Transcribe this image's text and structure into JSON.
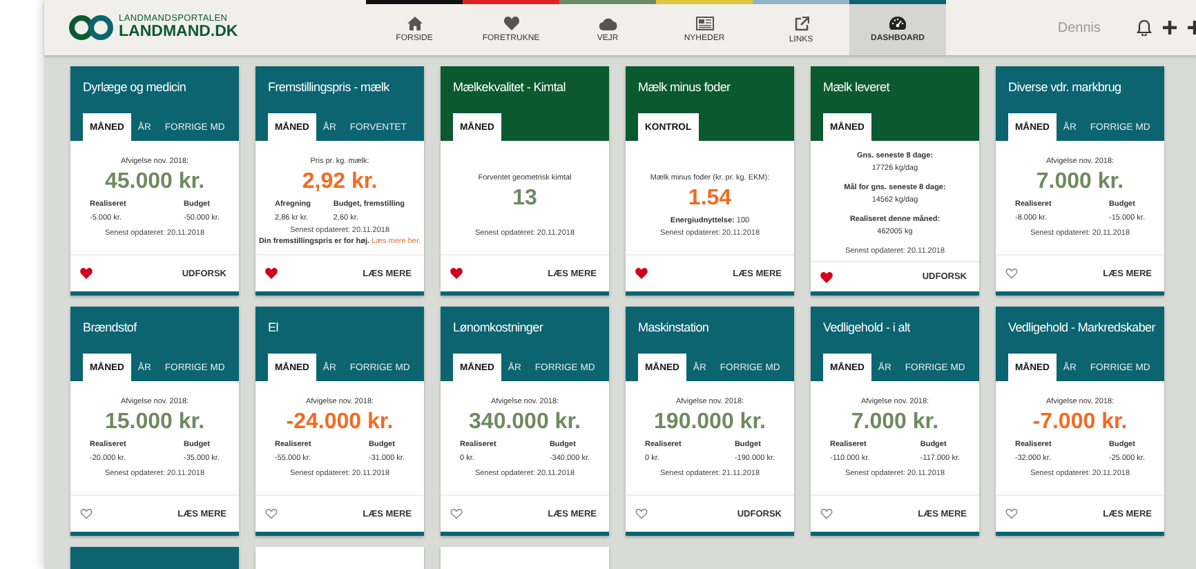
{
  "header": {
    "logo_top": "LANDMANDSPORTALEN",
    "logo_main": "LANDMAND.DK",
    "user": "Dennis"
  },
  "nav": [
    {
      "label": "FORSIDE",
      "color": "#111111",
      "selected": false
    },
    {
      "label": "FORETRUKNE",
      "color": "#e02020",
      "selected": false
    },
    {
      "label": "VEJR",
      "color": "#6f8a6a",
      "selected": false
    },
    {
      "label": "NYHEDER",
      "color": "#e3c53a",
      "selected": false
    },
    {
      "label": "LINKS",
      "color": "#8fb3c6",
      "selected": false
    },
    {
      "label": "DASHBOARD",
      "color": "#0b6470",
      "selected": true
    }
  ],
  "cards": [
    {
      "title": "Dyrlæge og medicin",
      "color": "#0b6470",
      "tabs": [
        {
          "label": "MÅNED",
          "selected": true
        },
        {
          "label": "ÅR",
          "selected": false
        },
        {
          "label": "FORRIGE MD",
          "selected": false
        }
      ],
      "kind": "budget",
      "caption": "Afvigelse nov. 2018:",
      "value": "45.000 kr.",
      "alert": false,
      "cols": [
        {
          "label": "Realiseret",
          "value": "-5.000 kr."
        },
        {
          "label": "Budget",
          "value": "-50.000 kr."
        }
      ],
      "updated": "Senest opdateret: 20.11.2018",
      "favorite": true,
      "action": "UDFORSK"
    },
    {
      "title": "Fremstillingspris - mælk",
      "color": "#0b6470",
      "tabs": [
        {
          "label": "MÅNED",
          "selected": true
        },
        {
          "label": "ÅR",
          "selected": false
        },
        {
          "label": "FORVENTET",
          "selected": false
        }
      ],
      "kind": "budget",
      "caption": "Pris pr. kg. mælk:",
      "value": "2,92 kr.",
      "alert": true,
      "cols": [
        {
          "label": "Afregning",
          "value": "2,86 kr kr."
        },
        {
          "label": "Budget, fremstilling",
          "value": "2,60 kr."
        }
      ],
      "updated": "Senest opdateret: 20.11.2018",
      "note": {
        "text": "Din fremstillingspris er for høj.",
        "link": "Læs mere her."
      },
      "favorite": true,
      "action": "LÆS MERE"
    },
    {
      "title": "Mælkekvalitet - Kimtal",
      "color": "#0b5a2f",
      "tabs": [
        {
          "label": "MÅNED",
          "selected": true
        }
      ],
      "kind": "single",
      "caption": "Forventet geometrisk kimtal",
      "value": "13",
      "alert": false,
      "updated": "Senest opdateret: 20.11.2018",
      "favorite": true,
      "action": "LÆS MERE"
    },
    {
      "title": "Mælk minus foder",
      "color": "#0b5a2f",
      "tabs": [
        {
          "label": "KONTROL",
          "selected": true
        }
      ],
      "kind": "single",
      "caption": "Mælk minus foder (kr. pr. kg. EKM):",
      "value": "1.54",
      "alert": true,
      "extra": "**Energiudnyttelse:** 100",
      "updated": "Senest opdateret: 20.11.2018",
      "favorite": true,
      "action": "LÆS MERE"
    },
    {
      "title": "Mælk leveret",
      "color": "#0b5a2f",
      "tabs": [
        {
          "label": "MÅNED",
          "selected": true
        }
      ],
      "kind": "stats",
      "stats": [
        {
          "label": "Gns. seneste 8 dage:",
          "value": "17726 kg/dag"
        },
        {
          "label": "Mål for gns. seneste 8 dage:",
          "value": "14562 kg/dag"
        },
        {
          "label": "Realiseret denne måned:",
          "value": "462005 kg"
        }
      ],
      "updated": "Senest opdateret: 20.11.2018",
      "favorite": true,
      "action": "UDFORSK"
    },
    {
      "title": "Diverse vdr. markbrug",
      "color": "#0b6470",
      "tabs": [
        {
          "label": "MÅNED",
          "selected": true
        },
        {
          "label": "ÅR",
          "selected": false
        },
        {
          "label": "FORRIGE MD",
          "selected": false
        }
      ],
      "kind": "budget",
      "caption": "Afvigelse nov. 2018:",
      "value": "7.000 kr.",
      "alert": false,
      "cols": [
        {
          "label": "Realiseret",
          "value": "-8.000 kr."
        },
        {
          "label": "Budget",
          "value": "-15.000 kr."
        }
      ],
      "updated": "Senest opdateret: 20.11.2018",
      "favorite": false,
      "action": "LÆS MERE"
    },
    {
      "title": "Brændstof",
      "color": "#0b6470",
      "tabs": [
        {
          "label": "MÅNED",
          "selected": true
        },
        {
          "label": "ÅR",
          "selected": false
        },
        {
          "label": "FORRIGE MD",
          "selected": false
        }
      ],
      "kind": "budget",
      "caption": "Afvigelse nov. 2018:",
      "value": "15.000 kr.",
      "alert": false,
      "cols": [
        {
          "label": "Realiseret",
          "value": "-20.000 kr."
        },
        {
          "label": "Budget",
          "value": "-35.000 kr."
        }
      ],
      "updated": "Senest opdateret: 20.11.2018",
      "favorite": false,
      "action": "LÆS MERE"
    },
    {
      "title": "El",
      "color": "#0b6470",
      "tabs": [
        {
          "label": "MÅNED",
          "selected": true
        },
        {
          "label": "ÅR",
          "selected": false
        },
        {
          "label": "FORRIGE MD",
          "selected": false
        }
      ],
      "kind": "budget",
      "caption": "Afvigelse nov. 2018:",
      "value": "-24.000 kr.",
      "alert": true,
      "cols": [
        {
          "label": "Realiseret",
          "value": "-55.000 kr."
        },
        {
          "label": "Budget",
          "value": "-31.000 kr."
        }
      ],
      "updated": "Senest opdateret: 20.11.2018",
      "favorite": false,
      "action": "LÆS MERE"
    },
    {
      "title": "Lønomkostninger",
      "color": "#0b6470",
      "tabs": [
        {
          "label": "MÅNED",
          "selected": true
        },
        {
          "label": "ÅR",
          "selected": false
        },
        {
          "label": "FORRIGE MD",
          "selected": false
        }
      ],
      "kind": "budget",
      "caption": "Afvigelse nov. 2018:",
      "value": "340.000 kr.",
      "alert": false,
      "cols": [
        {
          "label": "Realiseret",
          "value": "0 kr."
        },
        {
          "label": "Budget",
          "value": "-340.000 kr."
        }
      ],
      "updated": "Senest opdateret: 20.11.2018",
      "favorite": false,
      "action": "LÆS MERE"
    },
    {
      "title": "Maskinstation",
      "color": "#0b6470",
      "tabs": [
        {
          "label": "MÅNED",
          "selected": true
        },
        {
          "label": "ÅR",
          "selected": false
        },
        {
          "label": "FORRIGE MD",
          "selected": false
        }
      ],
      "kind": "budget",
      "caption": "Afvigelse nov. 2018:",
      "value": "190.000 kr.",
      "alert": false,
      "cols": [
        {
          "label": "Realiseret",
          "value": "0 kr."
        },
        {
          "label": "Budget",
          "value": "-190.000 kr."
        }
      ],
      "updated": "Senest opdateret: 21.11.2018",
      "favorite": false,
      "action": "UDFORSK"
    },
    {
      "title": "Vedligehold - i alt",
      "color": "#0b6470",
      "tabs": [
        {
          "label": "MÅNED",
          "selected": true
        },
        {
          "label": "ÅR",
          "selected": false
        },
        {
          "label": "FORRIGE MD",
          "selected": false
        }
      ],
      "kind": "budget",
      "caption": "Afvigelse nov. 2018:",
      "value": "7.000 kr.",
      "alert": false,
      "cols": [
        {
          "label": "Realiseret",
          "value": "-110.000 kr."
        },
        {
          "label": "Budget",
          "value": "-117.000 kr."
        }
      ],
      "updated": "Senest opdateret: 20.11.2018",
      "favorite": false,
      "action": "LÆS MERE"
    },
    {
      "title": "Vedligehold - Markredskaber",
      "color": "#0b6470",
      "tabs": [
        {
          "label": "MÅNED",
          "selected": true
        },
        {
          "label": "ÅR",
          "selected": false
        },
        {
          "label": "FORRIGE MD",
          "selected": false
        }
      ],
      "kind": "budget",
      "caption": "Afvigelse nov. 2018:",
      "value": "-7.000 kr.",
      "alert": true,
      "cols": [
        {
          "label": "Realiseret",
          "value": "-32.000 kr."
        },
        {
          "label": "Budget",
          "value": "-25.000 kr."
        }
      ],
      "updated": "Senest opdateret: 20.11.2018",
      "favorite": false,
      "action": "LÆS MERE"
    },
    {
      "color": "#0b6470",
      "kind": "stub"
    },
    {
      "color": "#ffffff",
      "kind": "stub"
    },
    {
      "color": "#ffffff",
      "kind": "stub"
    }
  ]
}
